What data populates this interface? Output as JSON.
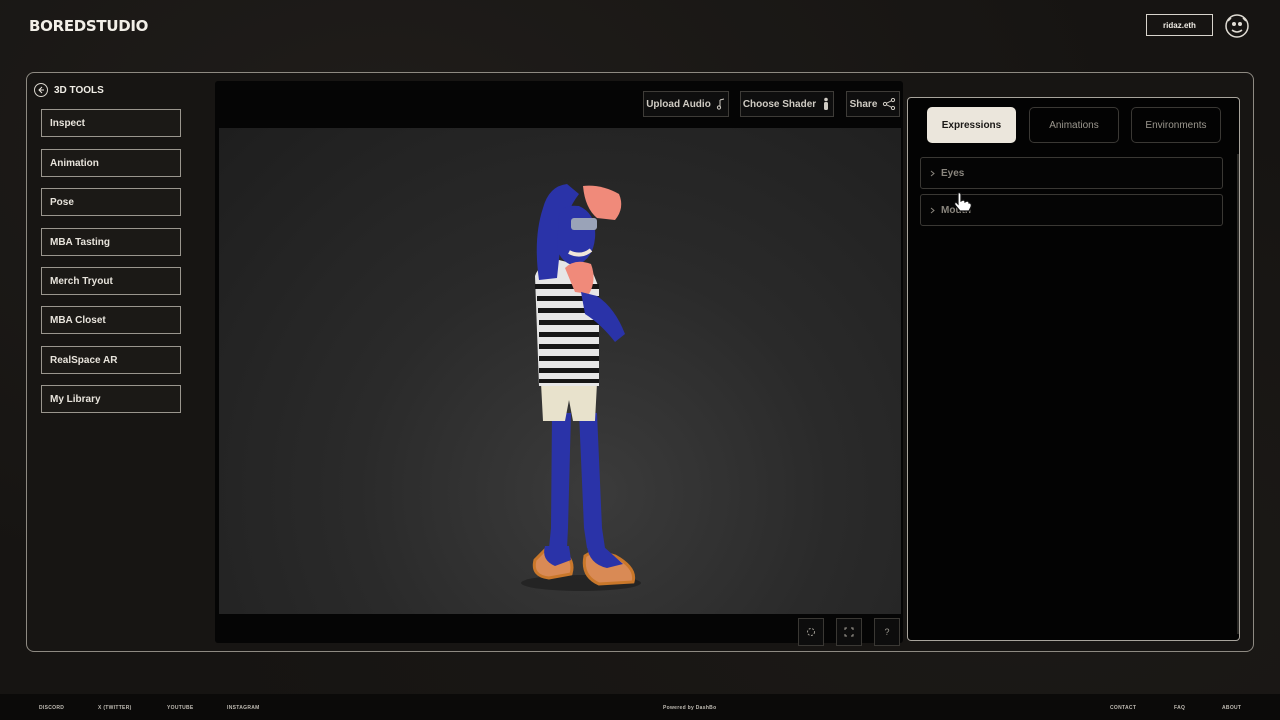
{
  "brand": {
    "logo": "BOREDSTUDIO"
  },
  "header": {
    "wallet_label": "ridaz.eth"
  },
  "sidebar": {
    "title": "3D TOOLS",
    "items": [
      {
        "label": "Inspect"
      },
      {
        "label": "Animation"
      },
      {
        "label": "Pose"
      },
      {
        "label": "MBA Tasting"
      },
      {
        "label": "Merch Tryout"
      },
      {
        "label": "MBA Closet"
      },
      {
        "label": "RealSpace AR"
      },
      {
        "label": "My Library"
      }
    ]
  },
  "viewer": {
    "toolbar": {
      "upload_audio": "Upload Audio",
      "choose_shader": "Choose Shader",
      "share": "Share"
    },
    "bottom_controls": {
      "help": "?"
    },
    "colors": {
      "suit": "#2a33a8",
      "stripe_dark": "#1a1a1a",
      "shorts": "#e8e2cc",
      "skin": "#f08a7a",
      "sandal": "#c9772a"
    }
  },
  "panel": {
    "tabs": [
      {
        "label": "Expressions",
        "active": true
      },
      {
        "label": "Animations",
        "active": false
      },
      {
        "label": "Environments",
        "active": false
      }
    ],
    "sections": [
      {
        "label": "Eyes"
      },
      {
        "label": "Mouth"
      }
    ]
  },
  "footer": {
    "left_links": [
      "DISCORD",
      "X (TWITTER)",
      "YOUTUBE",
      "INSTAGRAM"
    ],
    "powered_by": "Powered by DashBo",
    "right_links": [
      "CONTACT",
      "FAQ",
      "ABOUT"
    ]
  }
}
